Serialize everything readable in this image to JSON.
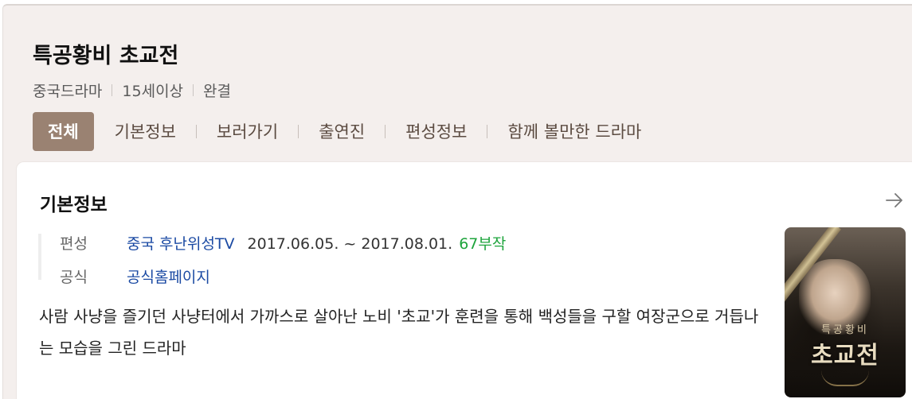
{
  "title": "특공황비 초교전",
  "meta": [
    "중국드라마",
    "15세이상",
    "완결"
  ],
  "tabs": [
    {
      "label": "전체",
      "active": true
    },
    {
      "label": "기본정보"
    },
    {
      "label": "보러가기"
    },
    {
      "label": "출연진"
    },
    {
      "label": "편성정보"
    },
    {
      "label": "함께 볼만한 드라마"
    }
  ],
  "section": {
    "title": "기본정보",
    "more_icon": "arrow-right-icon",
    "broadcast": {
      "label": "편성",
      "channel": "중국 후난위성TV",
      "period": "2017.06.05. ~ 2017.08.01.",
      "episodes": "67부작"
    },
    "official": {
      "label": "공식",
      "link": "공식홈페이지"
    },
    "description": "사람 사냥을 즐기던 사냥터에서 가까스로 살아난 노비 '초교'가 훈련을 통해 백성들을 구할 여장군으로 거듭나는 모습을 그린 드라마"
  },
  "poster": {
    "subtitle": "특공황비",
    "title": "초교전"
  },
  "colors": {
    "panel_bg": "#f4efed",
    "tab_active_bg": "#9a8272",
    "link": "#1b4aa3",
    "episodes": "#1ea43c"
  }
}
